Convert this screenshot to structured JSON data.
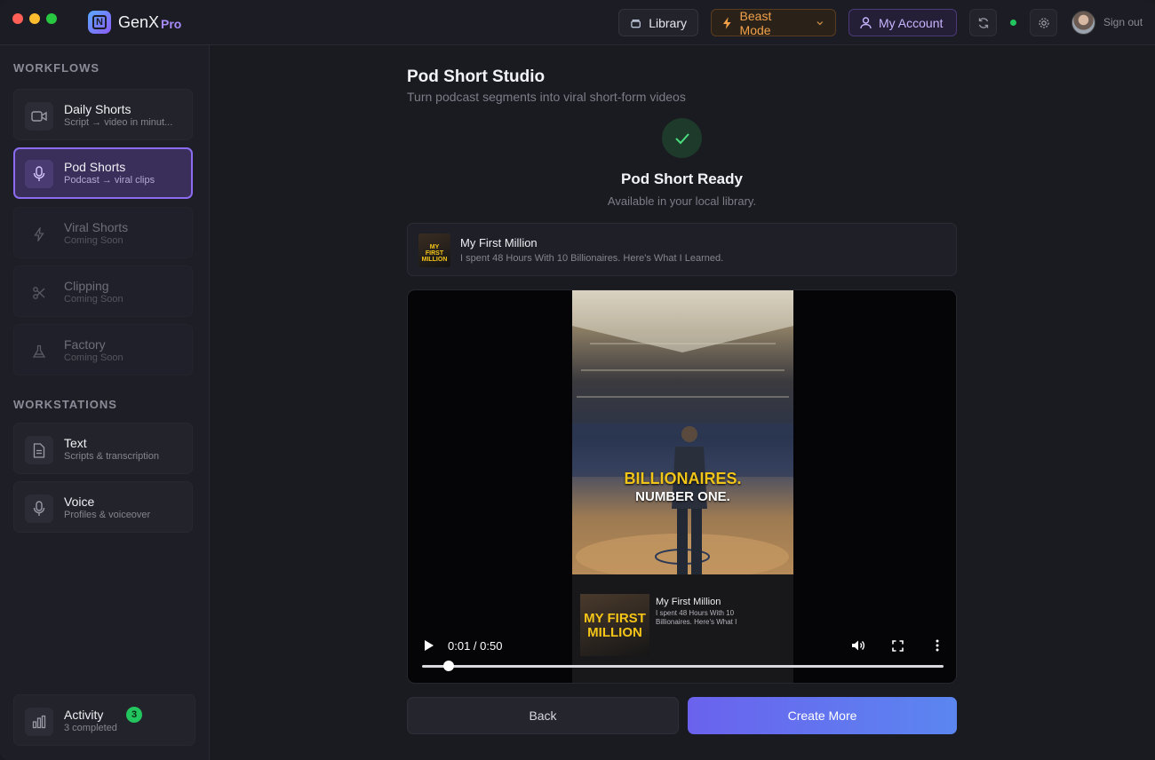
{
  "app": {
    "name": "GenX",
    "tier": "Pro"
  },
  "topbar": {
    "library_label": "Library",
    "beast_label": "Beast Mode",
    "account_label": "My Account",
    "signout_label": "Sign out",
    "status_color": "#22c55e"
  },
  "sidebar": {
    "workflows_title": "WORKFLOWS",
    "workflows": [
      {
        "title": "Daily Shorts",
        "subtitle": "Script → video in minut...",
        "icon": "video-camera-icon",
        "state": "normal"
      },
      {
        "title": "Pod Shorts",
        "subtitle": "Podcast → viral clips",
        "icon": "microphone-icon",
        "state": "active"
      },
      {
        "title": "Viral Shorts",
        "subtitle": "Coming Soon",
        "icon": "lightning-icon",
        "state": "disabled"
      },
      {
        "title": "Clipping",
        "subtitle": "Coming Soon",
        "icon": "scissors-icon",
        "state": "disabled"
      },
      {
        "title": "Factory",
        "subtitle": "Coming Soon",
        "icon": "flask-icon",
        "state": "disabled"
      }
    ],
    "workstations_title": "WORKSTATIONS",
    "workstations": [
      {
        "title": "Text",
        "subtitle": "Scripts & transcription",
        "icon": "document-icon"
      },
      {
        "title": "Voice",
        "subtitle": "Profiles & voiceover",
        "icon": "microphone-icon"
      }
    ],
    "activity": {
      "title": "Activity",
      "subtitle": "3 completed",
      "badge": "3",
      "icon": "bar-chart-icon"
    }
  },
  "main": {
    "title": "Pod Short Studio",
    "subtitle": "Turn podcast segments into viral short-form videos",
    "ready_title": "Pod Short Ready",
    "ready_subtitle": "Available in your local library.",
    "podcast": {
      "name": "My First Million",
      "episode": "I spent 48 Hours With 10 Billionaires. Here's What I Learned.",
      "thumb_text": "MY FIRST MILLION"
    },
    "video": {
      "caption_line1": "BILLIONAIRES.",
      "caption_line2": "NUMBER ONE.",
      "lower_thumb_text": "MY FIRST MILLION",
      "lower_name": "My First Million",
      "lower_desc": "I spent 48 Hours With 10 Billionaires. Here's What I",
      "current_time": "0:01",
      "duration": "0:50",
      "time_display": "0:01 / 0:50",
      "progress_fraction": 0.02
    },
    "back_label": "Back",
    "create_label": "Create More"
  }
}
